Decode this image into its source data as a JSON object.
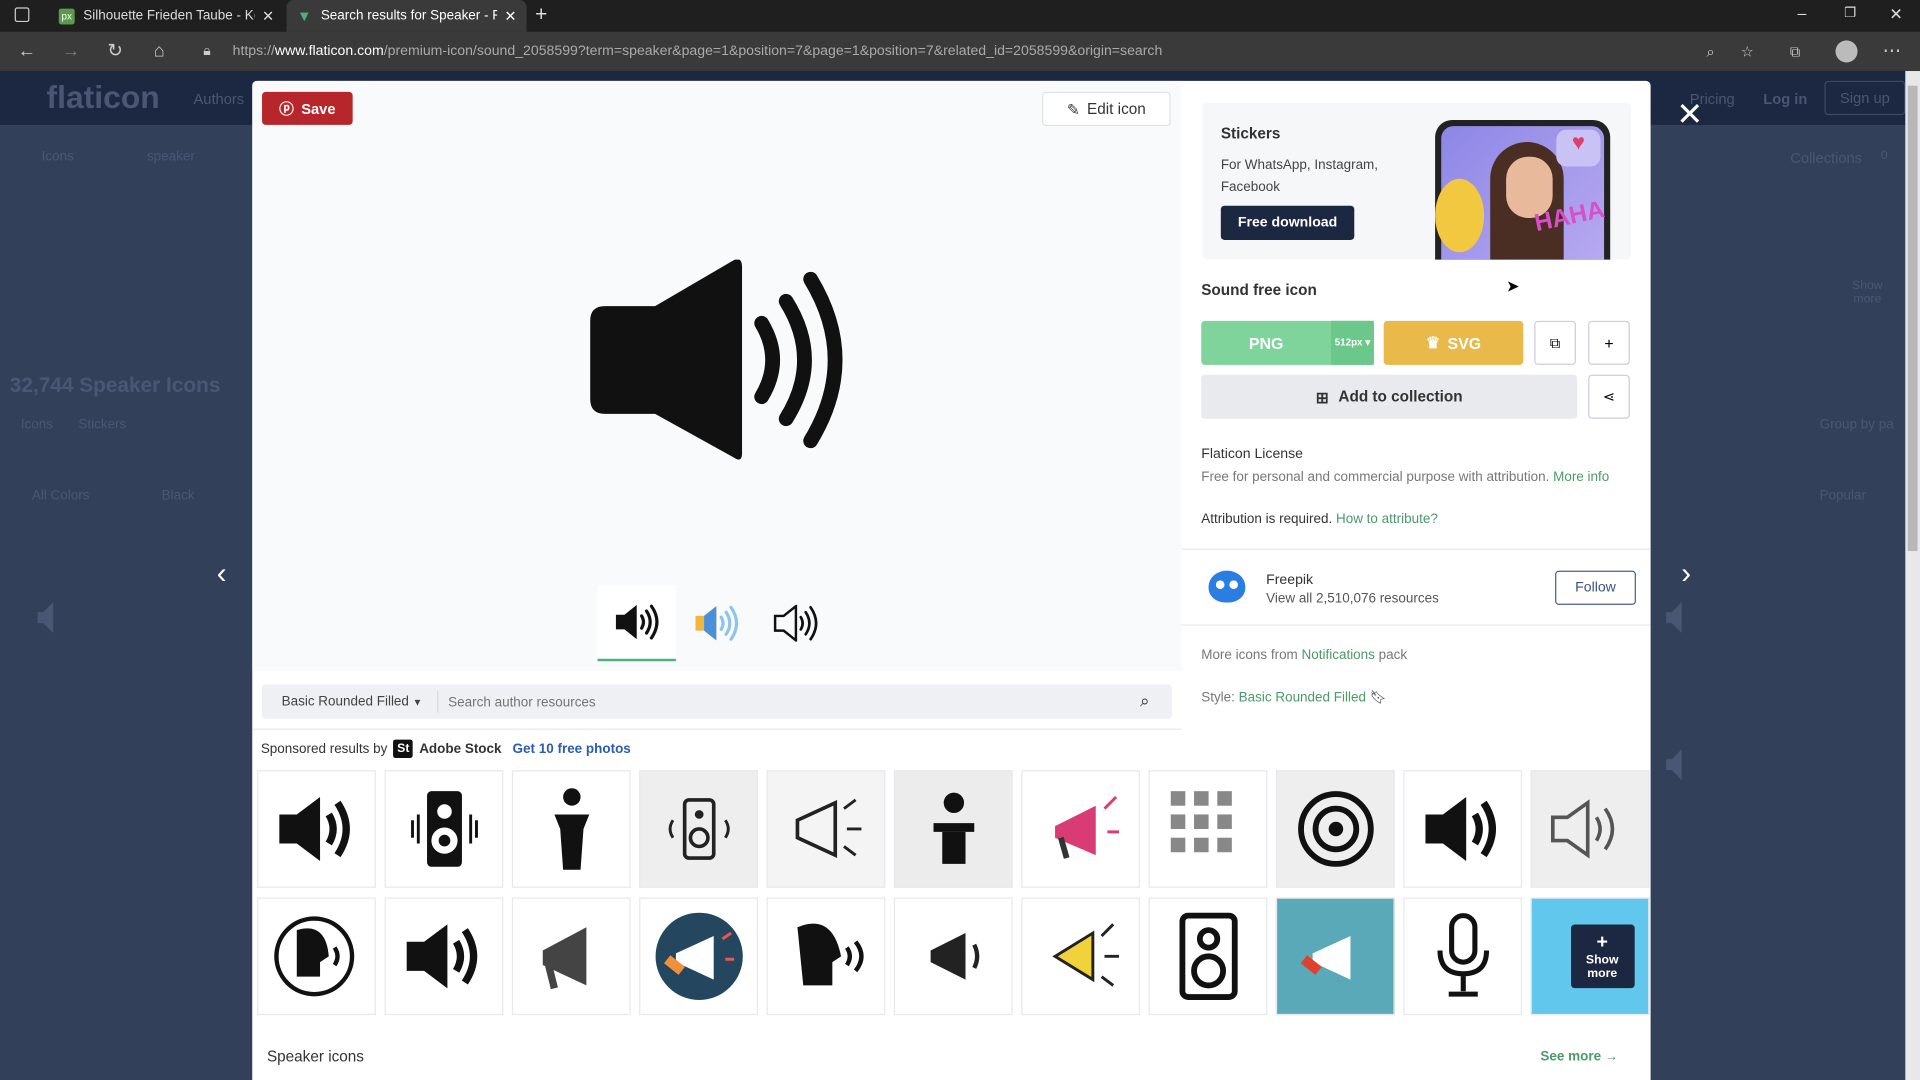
{
  "browser": {
    "tabs": [
      {
        "title": "Silhouette Frieden Taube - Koste",
        "favicon": "px",
        "active": false
      },
      {
        "title": "Search results for Speaker - Flati",
        "favicon": "flaticon",
        "active": true
      }
    ],
    "url_prefix": "https://",
    "url_domain": "www.flaticon.com",
    "url_rest": "/premium-icon/sound_2058599?term=speaker&page=1&position=7&page=1&position=7&related_id=2058599&origin=search"
  },
  "background": {
    "logo": "flaticon",
    "nav": [
      "Authors",
      "Pricing",
      "Log in",
      "Sign up"
    ],
    "search_type": "Icons",
    "search_value": "speaker",
    "collections_label": "Collections",
    "collections_count": "0",
    "result_title": "32,744 Speaker Icons",
    "tabs": [
      "Icons",
      "Stickers"
    ],
    "filters": [
      "All Colors",
      "Black"
    ],
    "group_by": "Group by pa",
    "sort": "Popular",
    "show_more": "Show more"
  },
  "modal": {
    "save_label": "Save",
    "edit_label": "Edit icon",
    "variants": [
      "filled-black",
      "color-blue-yellow",
      "outline"
    ],
    "style_select": "Basic Rounded Filled",
    "search_placeholder": "Search author resources",
    "sponsored_prefix": "Sponsored results by",
    "sponsor_name": "Adobe Stock",
    "sponsor_logo": "St",
    "sponsor_cta": "Get 10 free photos",
    "stock_tiles": [
      "speaker-volume",
      "speaker-box-waves",
      "person-podium",
      "speaker-box-grey",
      "megaphone-outline",
      "podium-speaker",
      "megaphone-pink",
      "icon-set",
      "woofer",
      "speaker-volume",
      "speaker-outline",
      "head-speaking-circle",
      "speaker-volume",
      "megaphone",
      "megaphone-circle",
      "head-speaking",
      "megaphone-small",
      "megaphone-yellow",
      "speaker-box-outline",
      "megaphone-teal",
      "microphone",
      "show-more"
    ],
    "show_more_label": "Show more",
    "section_title": "Speaker icons",
    "see_more": "See more",
    "ad": {
      "title": "Stickers",
      "text": "For WhatsApp, Instagram, Facebook",
      "cta": "Free download",
      "sticker_text": "HAHA"
    },
    "icon_title": "Sound free icon",
    "png_label": "PNG",
    "png_size": "512px",
    "svg_label": "SVG",
    "add_collection_label": "Add to collection",
    "license_title": "Flaticon License",
    "license_text": "Free for personal and commercial purpose with attribution.",
    "license_more": "More info",
    "attribution_text": "Attribution is required.",
    "attribution_link": "How to attribute?",
    "author_name": "Freepik",
    "author_resources": "View all 2,510,076 resources",
    "follow_label": "Follow",
    "pack_prefix": "More icons from",
    "pack_name": "Notifications",
    "pack_suffix": "pack",
    "style_prefix": "Style:",
    "style_name": "Basic Rounded Filled"
  },
  "colors": {
    "save": "#b7262b",
    "png": "#7fd49b",
    "svg": "#e9b949",
    "accent_green": "#4a9a6b",
    "ad_button": "#1c2741",
    "overlay": "#33405a"
  }
}
